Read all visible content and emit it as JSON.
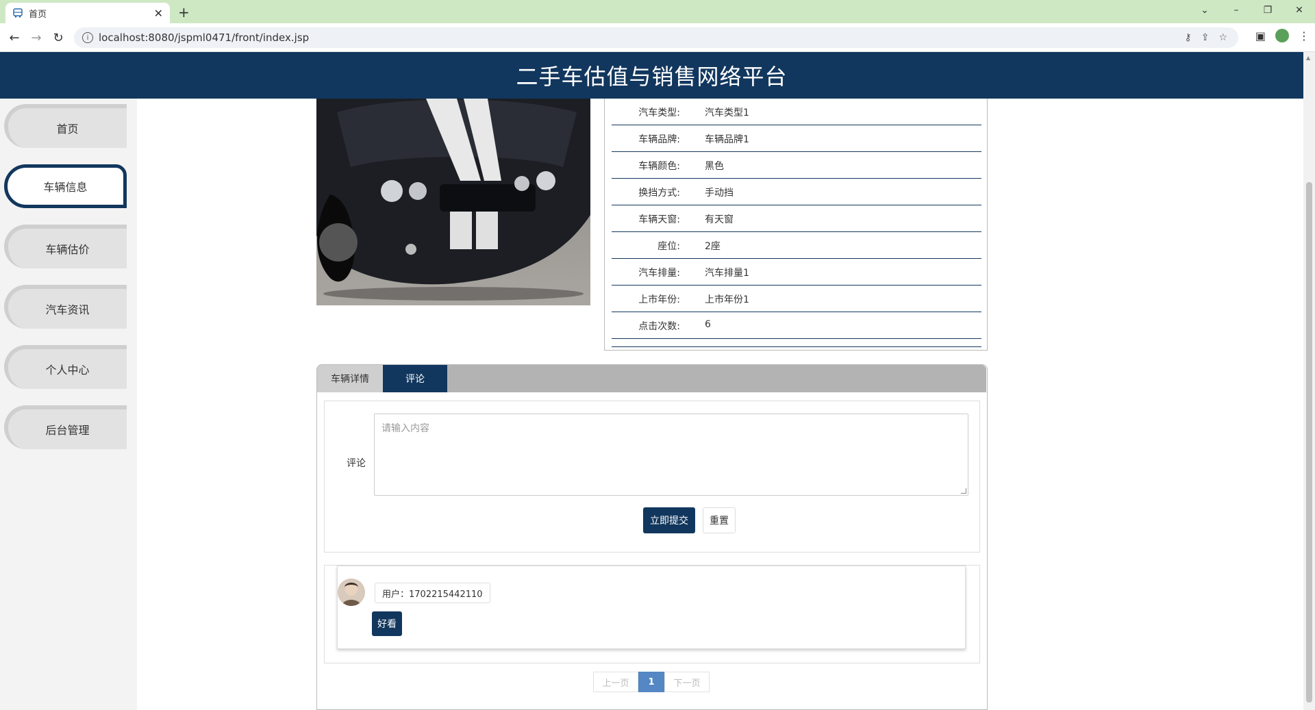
{
  "browser": {
    "tab_title": "首页",
    "url": "localhost:8080/jspml0471/front/index.jsp"
  },
  "header": {
    "title": "二手车估值与销售网络平台"
  },
  "sidebar": {
    "items": [
      {
        "label": "首页"
      },
      {
        "label": "车辆信息",
        "active": true
      },
      {
        "label": "车辆估价"
      },
      {
        "label": "汽车资讯"
      },
      {
        "label": "个人中心"
      },
      {
        "label": "后台管理"
      }
    ]
  },
  "details": [
    {
      "key": "汽车类型:",
      "value": "汽车类型1"
    },
    {
      "key": "车辆品牌:",
      "value": "车辆品牌1"
    },
    {
      "key": "车辆颜色:",
      "value": "黑色"
    },
    {
      "key": "换挡方式:",
      "value": "手动挡"
    },
    {
      "key": "车辆天窗:",
      "value": "有天窗"
    },
    {
      "key": "座位:",
      "value": "2座"
    },
    {
      "key": "汽车排量:",
      "value": "汽车排量1"
    },
    {
      "key": "上市年份:",
      "value": "上市年份1"
    },
    {
      "key": "点击次数:",
      "value": "6"
    }
  ],
  "tabs": [
    {
      "label": "车辆详情"
    },
    {
      "label": "评论",
      "active": true
    }
  ],
  "comment_form": {
    "label": "评论",
    "placeholder": "请输入内容",
    "submit_label": "立即提交",
    "reset_label": "重置"
  },
  "comments": [
    {
      "user": "用户：1702215442110",
      "content": "好看"
    }
  ],
  "pager": {
    "prev": "上一页",
    "current": "1",
    "next": "下一页"
  },
  "colors": {
    "brand": "#12375e",
    "pager_active": "#5487c4",
    "tab_strip": "#cfe8c4"
  }
}
